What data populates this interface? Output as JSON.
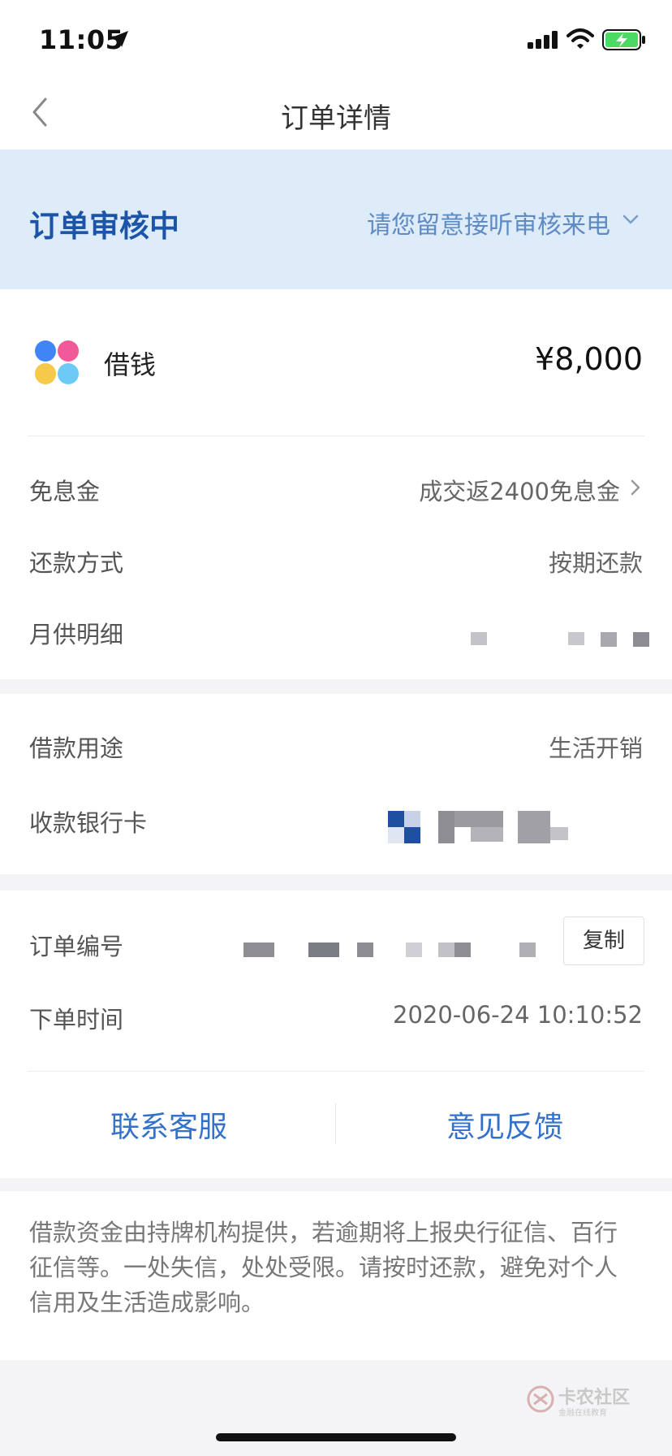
{
  "status_bar": {
    "time": "11:05"
  },
  "nav": {
    "title": "订单详情"
  },
  "banner": {
    "title": "订单审核中",
    "hint": "请您留意接听审核来电"
  },
  "loan": {
    "app_name": "借钱",
    "amount": "¥8,000"
  },
  "details": {
    "interest_free_label": "免息金",
    "interest_free_value": "成交返2400免息金",
    "repayment_method_label": "还款方式",
    "repayment_method_value": "按期还款",
    "monthly_detail_label": "月供明细",
    "loan_purpose_label": "借款用途",
    "loan_purpose_value": "生活开销",
    "bank_card_label": "收款银行卡",
    "order_no_label": "订单编号",
    "copy_label": "复制",
    "order_time_label": "下单时间",
    "order_time_value": "2020-06-24 10:10:52"
  },
  "actions": {
    "contact_service": "联系客服",
    "feedback": "意见反馈"
  },
  "disclaimer": "借款资金由持牌机构提供，若逾期将上报央行征信、百行征信等。一处失信，处处受限。请按时还款，避免对个人信用及生活造成影响。",
  "watermark": {
    "text": "卡农社区",
    "sub": "金融在线教育"
  },
  "colors": {
    "banner_bg": "#deebf8",
    "banner_title": "#1c55a8",
    "accent_link": "#3472c9",
    "battery_green": "#4cd964"
  },
  "icons": {
    "back": "chevron-left-icon",
    "expand": "chevron-down-icon",
    "next": "chevron-right-icon",
    "app_logo": "four-petal-logo-icon"
  }
}
